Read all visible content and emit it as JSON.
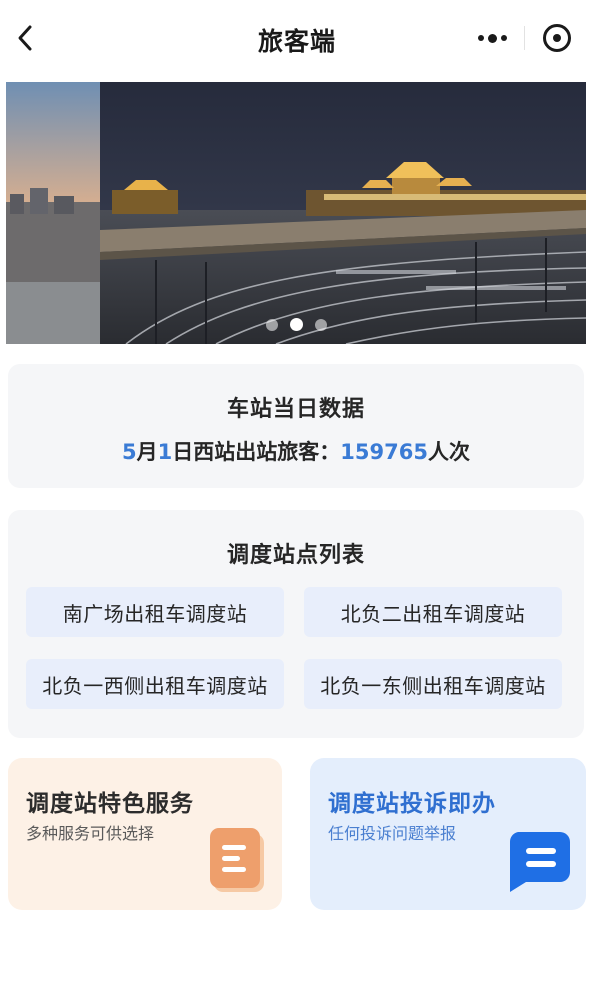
{
  "navbar": {
    "title": "旅客端",
    "back_icon": "chevron-left-icon",
    "more_icon": "more-dots-icon",
    "close_icon": "target-close-icon"
  },
  "banner": {
    "image": "night view of railway station with tracks",
    "active_slide": 2,
    "slide_count": 3
  },
  "daily_data": {
    "title": "车站当日数据",
    "month": "5",
    "month_unit": "月",
    "day": "1",
    "day_unit": "日西站出站旅客：",
    "count": "159765",
    "count_unit": "人次"
  },
  "station_list": {
    "title": "调度站点列表",
    "stations": [
      "南广场出租车调度站",
      "北负二出租车调度站",
      "北负一西侧出租车调度站",
      "北负一东侧出租车调度站"
    ]
  },
  "features": {
    "service": {
      "title": "调度站特色服务",
      "subtitle": "多种服务可供选择",
      "icon": "document-icon"
    },
    "complaint": {
      "title": "调度站投诉即办",
      "subtitle": "任何投诉问题举报",
      "icon": "chat-bubble-icon"
    }
  },
  "colors": {
    "accent_blue": "#3a7bd5",
    "orange_icon": "#ee9f6c",
    "chat_blue": "#1f6fe5"
  }
}
